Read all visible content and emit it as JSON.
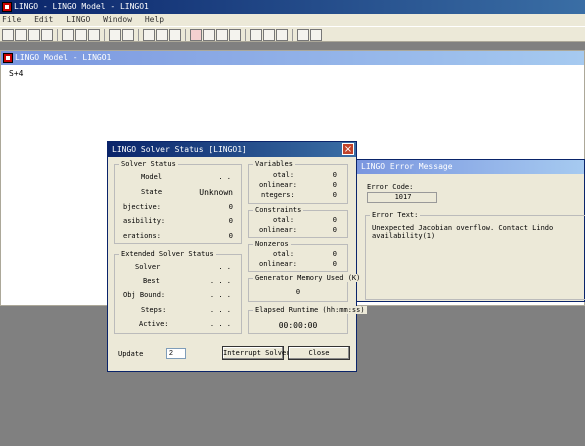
{
  "main_window": {
    "title": "LINGO - LINGO Model - LINGO1"
  },
  "menu": [
    "File",
    "Edit",
    "LINGO",
    "Window",
    "Help"
  ],
  "editor": {
    "title": "LINGO Model - LINGO1",
    "content": "S+4"
  },
  "solver_status": {
    "title": "LINGO Solver Status [LINGO1]",
    "solver_status_group": "Solver Status",
    "model_label": "Model",
    "model_value": ". .",
    "state_label": "State",
    "state_value": "Unknown",
    "objective_label": "bjective:",
    "objective_value": "0",
    "infeasibility_label": "asibility:",
    "infeasibility_value": "0",
    "iterations_label": "erations:",
    "iterations_value": "0",
    "extended_group": "Extended Solver Status",
    "solver_label": "Solver",
    "solver_value": ". .",
    "best_label": "Best",
    "best_value": ". . .",
    "obj_bound_label": "Obj Bound:",
    "obj_bound_value": ". . .",
    "steps_label": "Steps:",
    "steps_value": ". . .",
    "active_label": "Active:",
    "active_value": ". . .",
    "variables_group": "Variables",
    "var_total_label": "otal:",
    "var_total_value": "0",
    "var_nonlinear_label": "onlinear:",
    "var_nonlinear_value": "0",
    "var_integers_label": "ntegers:",
    "var_integers_value": "0",
    "constraints_group": "Constraints",
    "con_total_label": "otal:",
    "con_total_value": "0",
    "con_nonlinear_label": "onlinear:",
    "con_nonlinear_value": "0",
    "nonzeros_group": "Nonzeros",
    "nz_total_label": "otal:",
    "nz_total_value": "0",
    "nz_nonlinear_label": "onlinear:",
    "nz_nonlinear_value": "0",
    "memory_group": "Generator Memory Used (K)",
    "memory_value": "0",
    "runtime_group": "Elapsed Runtime (hh:mm:ss)",
    "runtime_value": "00:00:00",
    "update_label": "Update",
    "update_value": "2",
    "interrupt_label": "Interrupt Solver",
    "close_label": "Close"
  },
  "error_dialog": {
    "title": "LINGO Error Message",
    "error_code_label": "Error Code:",
    "error_code": "1017",
    "error_text_label": "Error Text:",
    "error_text_line1": "Unexpected Jacobian overflow.  Contact Lindo",
    "error_text_line2": "availability(1)"
  },
  "colors": {
    "title_active": "#0a246a",
    "title_inactive": "#7a96df",
    "workspace": "#808080",
    "dialog_bg": "#ece9d8"
  }
}
